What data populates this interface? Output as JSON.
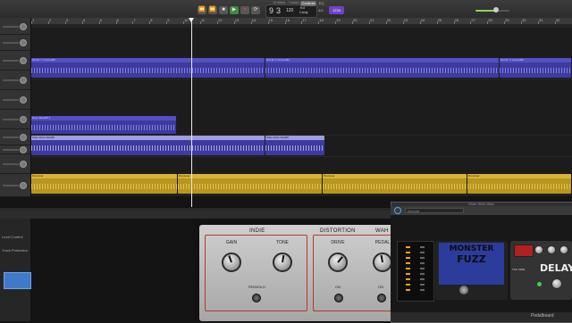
{
  "window": {
    "title": "Untitled - Tracks"
  },
  "transport": {
    "position_bar": "9",
    "position_beat": "3",
    "tempo": "120",
    "key": "Kd",
    "key_sub": "Cmaj",
    "signature": "4/4",
    "tuner_label": "1234"
  },
  "master_volume_percent": 60,
  "ruler": {
    "bars": [
      "1",
      "2",
      "3",
      "4",
      "5",
      "6",
      "7",
      "8",
      "9",
      "10",
      "11",
      "12",
      "13",
      "14",
      "15",
      "16",
      "17",
      "18",
      "19",
      "20",
      "21",
      "22",
      "23",
      "24",
      "25",
      "26",
      "27",
      "28",
      "29",
      "30",
      "31",
      "32",
      "33"
    ]
  },
  "tracks": [
    {
      "regions": [
        {
          "name": "SoCal 'n' Groove80"
        },
        {
          "name": "SoCal 'n' Groove80"
        },
        {
          "name": "SoCal 'n' Groove80"
        }
      ]
    },
    {
      "regions": [
        {
          "name": "Dave Bass85 1"
        }
      ]
    },
    {
      "regions": [
        {
          "name": "Wide Wide Wah88"
        },
        {
          "name": "Wide Wide Wah88"
        }
      ]
    },
    {
      "regions": [
        {
          "name": "Drummer"
        },
        {
          "name": "Drummer"
        },
        {
          "name": "Drummer"
        },
        {
          "name": "Drummer"
        }
      ]
    }
  ],
  "smart_controls": {
    "tabs": [
      "Controls",
      "EQ"
    ]
  },
  "inspector": {
    "items": [
      "Level Control",
      "Track Protection"
    ]
  },
  "amp": {
    "sections": [
      "INDIE",
      "DISTORTION",
      "WAH"
    ],
    "knobs": [
      "GAIN",
      "TONE",
      "DRIVE",
      "PEDAL"
    ],
    "switches": [
      "TREMOLO",
      "ON",
      "ON"
    ]
  },
  "pedalboard": {
    "title": "Wide Wide Wah",
    "preset": "Manual",
    "fuzz_lines": [
      "MONSTER",
      "FUZZ"
    ],
    "delay_label": "DELAY",
    "delay_mode": "TSC TAPE",
    "footer_label": "Pedalboard"
  },
  "colors": {
    "region_blue": "#3d3b9e",
    "region_blue_header": "#5150c4",
    "region_gold": "#b8961f",
    "accent_purple": "#6b45c8",
    "amp_red": "#b23a2d"
  }
}
